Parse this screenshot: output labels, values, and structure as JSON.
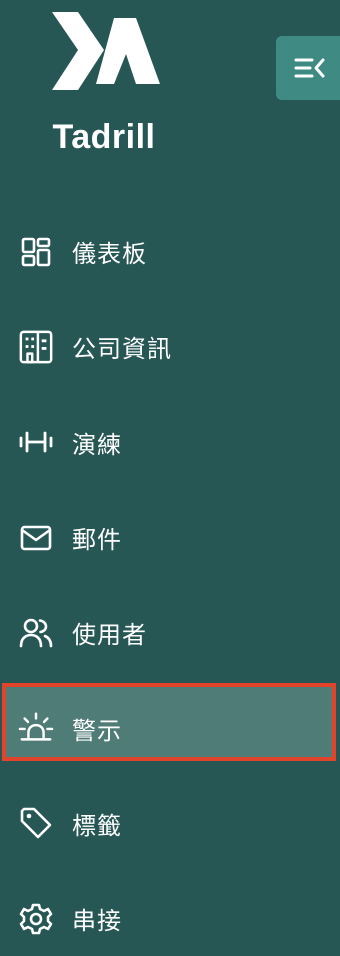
{
  "brand": {
    "name": "Tadrill"
  },
  "sidebar": {
    "collapse_icon": "menu-collapse-icon",
    "items": [
      {
        "label": "儀表板",
        "icon": "dashboard-icon",
        "active": false
      },
      {
        "label": "公司資訊",
        "icon": "building-icon",
        "active": false
      },
      {
        "label": "演練",
        "icon": "dumbbell-icon",
        "active": false
      },
      {
        "label": "郵件",
        "icon": "mail-icon",
        "active": false
      },
      {
        "label": "使用者",
        "icon": "users-icon",
        "active": false
      },
      {
        "label": "警示",
        "icon": "alert-siren-icon",
        "active": true
      },
      {
        "label": "標籤",
        "icon": "tag-icon",
        "active": false
      },
      {
        "label": "串接",
        "icon": "settings-gear-icon",
        "active": false
      }
    ]
  },
  "colors": {
    "background": "#275755",
    "active_bg": "#507c78",
    "active_border": "#e2442b",
    "button_bg": "#3f8a83"
  }
}
